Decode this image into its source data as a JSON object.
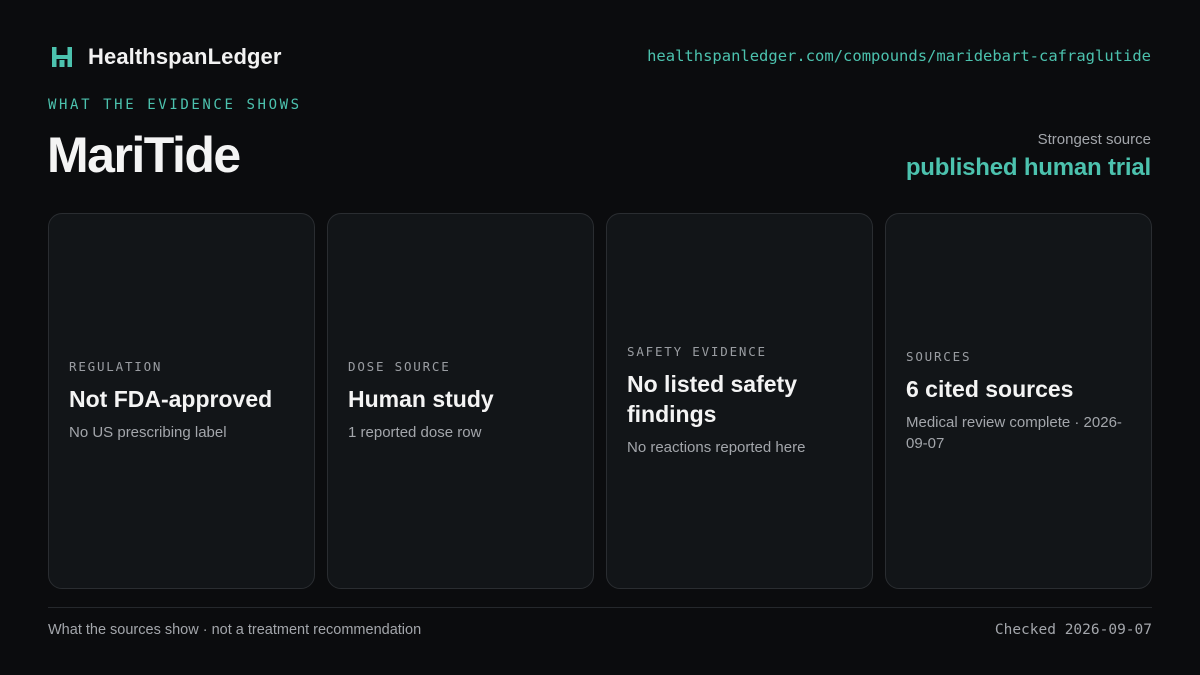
{
  "brand": {
    "name": "HealthspanLedger",
    "logo_icon": "ledger-h-icon",
    "accent_color": "#4cc2ae"
  },
  "url": "healthspanledger.com/compounds/maridebart-cafraglutide",
  "eyebrow": "WHAT THE EVIDENCE SHOWS",
  "title": "MariTide",
  "strongest": {
    "label": "Strongest source",
    "value": "published human trial"
  },
  "cards": [
    {
      "label": "REGULATION",
      "value": "Not FDA-approved",
      "detail": "No US prescribing label"
    },
    {
      "label": "DOSE SOURCE",
      "value": "Human study",
      "detail": "1 reported dose row"
    },
    {
      "label": "SAFETY EVIDENCE",
      "value": "No listed safety findings",
      "detail": "No reactions reported here"
    },
    {
      "label": "SOURCES",
      "value": "6 cited sources",
      "detail": "Medical review complete · 2026-09-07"
    }
  ],
  "footer": {
    "note": "What the sources show · not a treatment recommendation",
    "checked": "Checked 2026-09-07"
  }
}
